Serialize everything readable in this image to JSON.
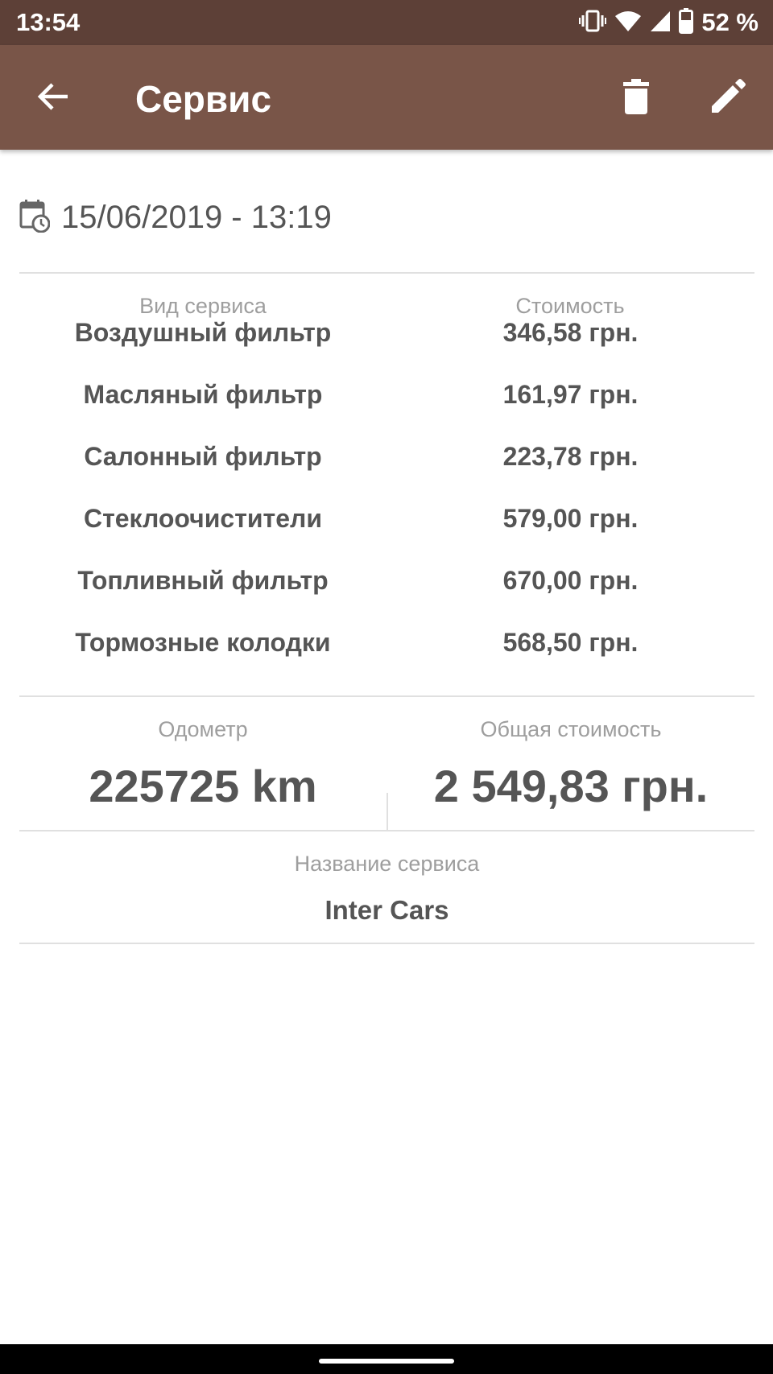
{
  "status_bar": {
    "time": "13:54",
    "battery": "52 %"
  },
  "app_bar": {
    "title": "Сервис"
  },
  "date": "15/06/2019 - 13:19",
  "table": {
    "col_service": "Вид сервиса",
    "col_cost": "Стоимость",
    "rows": [
      {
        "name": "Воздушный фильтр",
        "cost": "346,58 грн."
      },
      {
        "name": "Масляный фильтр",
        "cost": "161,97 грн."
      },
      {
        "name": "Салонный фильтр",
        "cost": "223,78 грн."
      },
      {
        "name": "Стеклоочистители",
        "cost": "579,00 грн."
      },
      {
        "name": "Топливный фильтр",
        "cost": "670,00 грн."
      },
      {
        "name": "Тормозные колодки",
        "cost": "568,50 грн."
      }
    ]
  },
  "summary": {
    "odometer_label": "Одометр",
    "odometer_value": "225725 km",
    "total_label": "Общая стоимость",
    "total_value": "2 549,83 грн."
  },
  "service_name": {
    "label": "Название сервиса",
    "value": "Inter Cars"
  },
  "colors": {
    "status_bar": "#5d4037",
    "app_bar": "#795548"
  }
}
